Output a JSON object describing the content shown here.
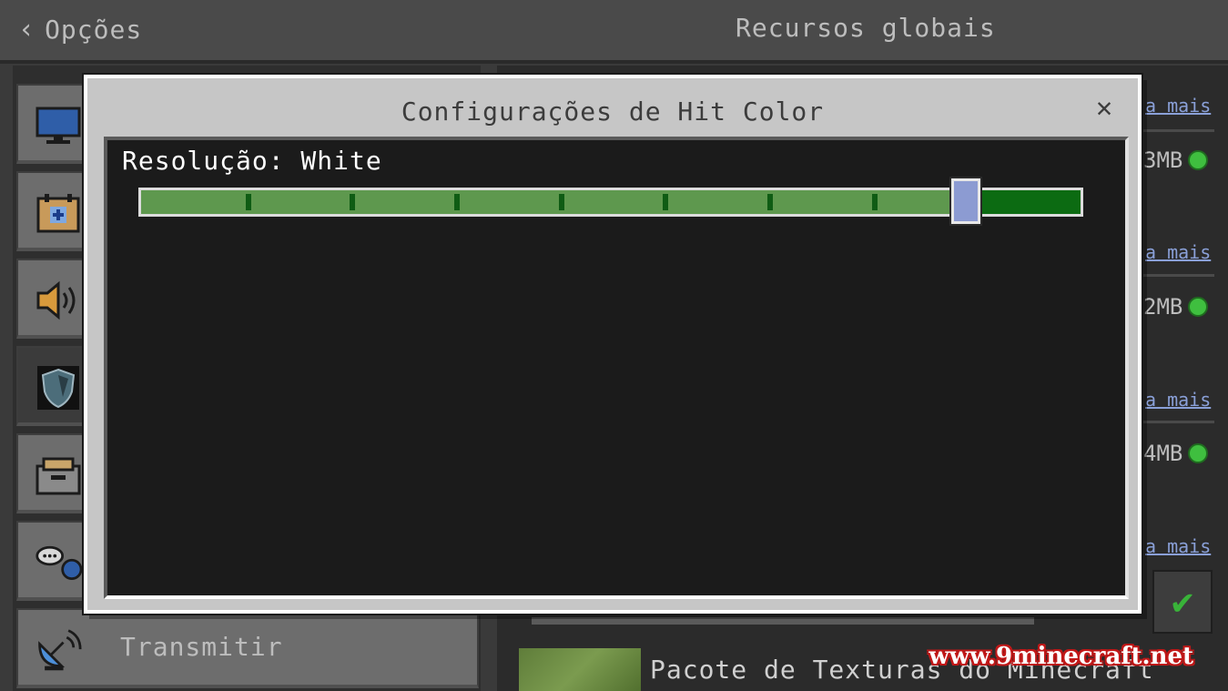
{
  "header": {
    "back_icon": "chevron-left-icon",
    "back_label": "Opções",
    "title": "Recursos globais"
  },
  "sidebar": {
    "items": [
      {
        "icon": "monitor-icon",
        "label": ""
      },
      {
        "icon": "calendar-plus-icon",
        "label": ""
      },
      {
        "icon": "speaker-icon",
        "label": ""
      },
      {
        "icon": "shield-icon",
        "label": ""
      },
      {
        "icon": "folder-icon",
        "label": ""
      },
      {
        "icon": "chat-globe-icon",
        "label": ""
      },
      {
        "icon": "satellite-dish-icon",
        "label": "Transmitir"
      }
    ]
  },
  "right_panel": {
    "more_link": "a mais",
    "sizes": [
      "3MB",
      "2MB",
      "4MB"
    ],
    "pack_name": "Pacote de Texturas do Minecraft",
    "check_icon": "checkmark-icon"
  },
  "modal": {
    "title": "Configurações de Hit Color",
    "close_icon": "close-icon",
    "slider_label": "Resolução: White",
    "slider_value_fraction": 0.89,
    "tick_count": 7
  },
  "watermark": "www.9minecraft.net",
  "colors": {
    "slider_track": "#0c6b12",
    "slider_fill": "#5e984e",
    "thumb": "#8c9bd2",
    "status_green": "#3fbf3f"
  }
}
